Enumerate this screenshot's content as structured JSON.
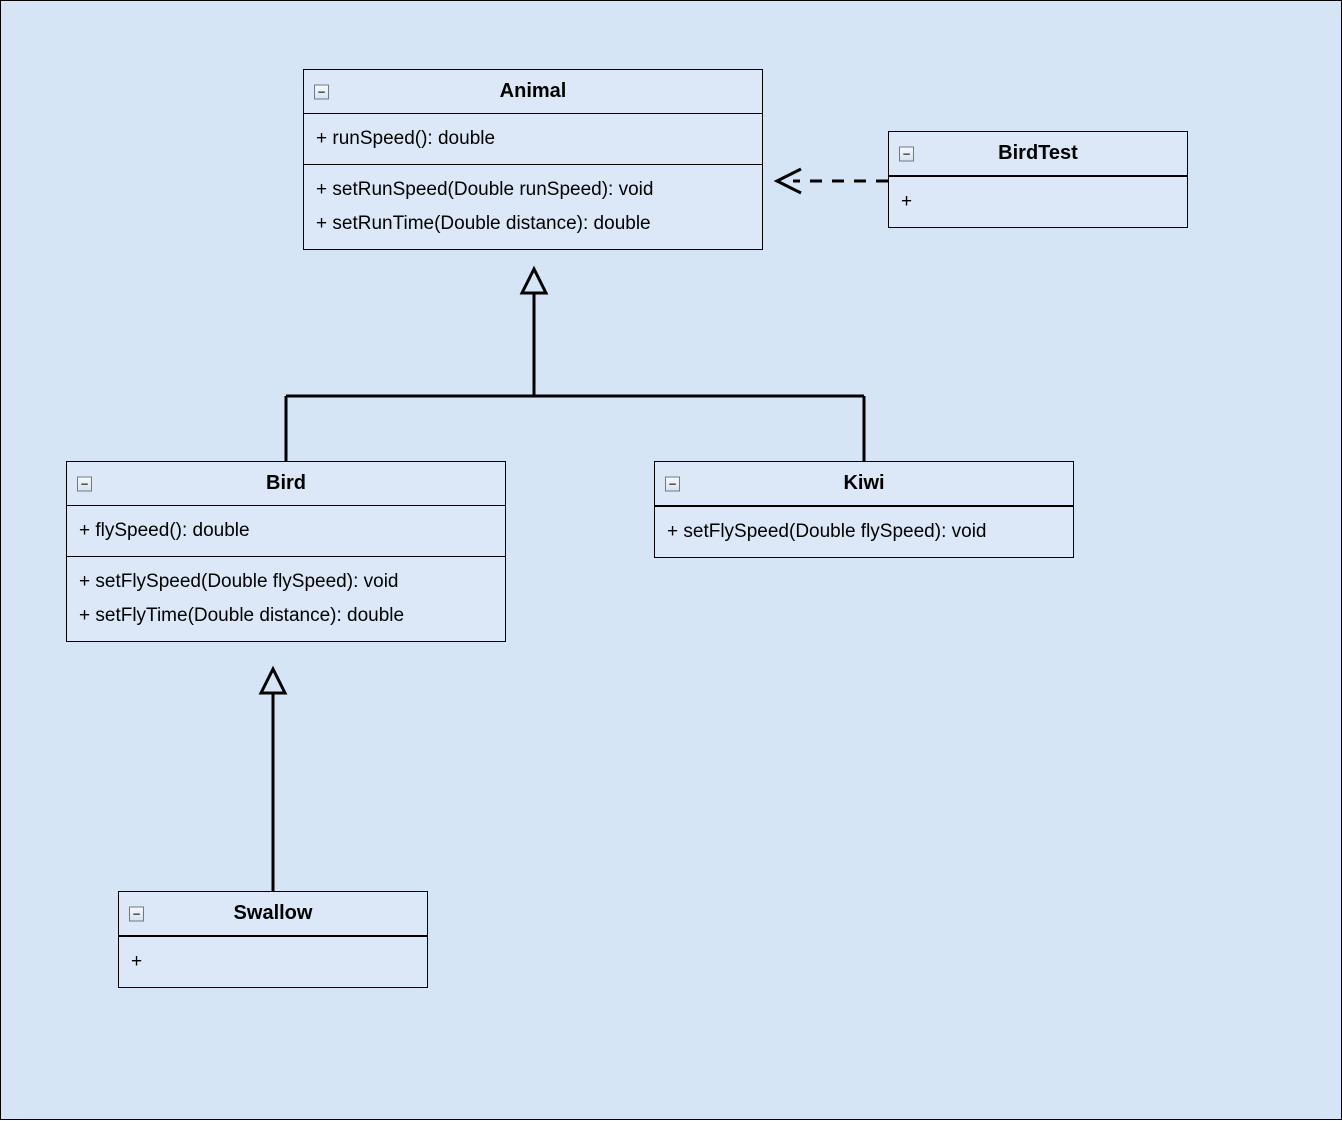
{
  "classes": {
    "animal": {
      "name": "Animal",
      "attrs": [
        "+ runSpeed(): double"
      ],
      "ops": [
        "+ setRunSpeed(Double runSpeed): void",
        "+ setRunTime(Double distance): double"
      ]
    },
    "birdtest": {
      "name": "BirdTest",
      "attrs": [],
      "ops": [
        "+"
      ]
    },
    "bird": {
      "name": "Bird",
      "attrs": [
        "+ flySpeed(): double"
      ],
      "ops": [
        "+ setFlySpeed(Double flySpeed): void",
        "+ setFlyTime(Double distance): double"
      ]
    },
    "kiwi": {
      "name": "Kiwi",
      "attrs": [],
      "ops": [
        "+ setFlySpeed(Double flySpeed): void"
      ]
    },
    "swallow": {
      "name": "Swallow",
      "attrs": [],
      "ops": [
        "+"
      ]
    }
  },
  "icons": {
    "collapse": "−"
  }
}
